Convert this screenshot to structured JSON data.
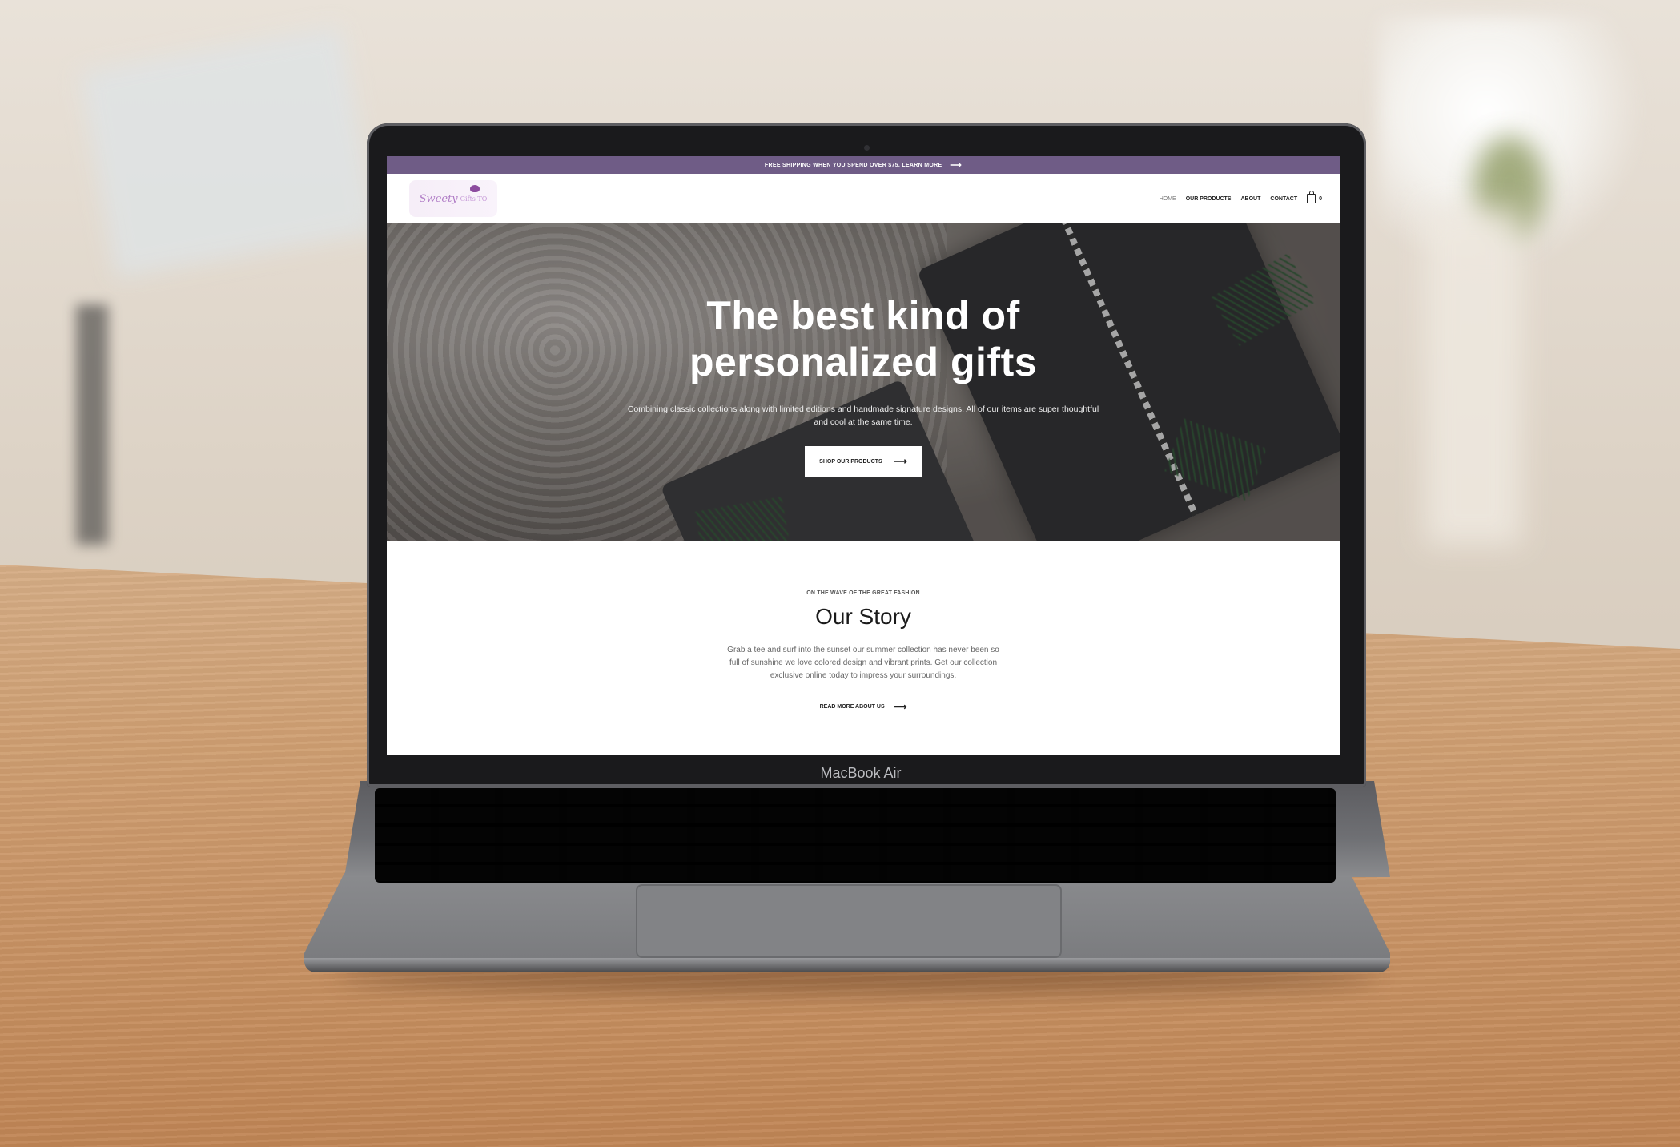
{
  "announcement": {
    "text": "FREE SHIPPING WHEN YOU SPEND OVER $75. LEARN MORE",
    "arrow": "⟶"
  },
  "logo": {
    "script": "Sweety",
    "sub": "Gifts TO"
  },
  "nav": {
    "items": [
      {
        "label": "HOME",
        "active": true
      },
      {
        "label": "OUR PRODUCTS",
        "active": false
      },
      {
        "label": "ABOUT",
        "active": false
      },
      {
        "label": "CONTACT",
        "active": false
      }
    ],
    "cart_count": "0",
    "cart_icon": "shopping-bag-icon"
  },
  "hero": {
    "title_line1": "The best kind of",
    "title_line2": "personalized gifts",
    "subtitle": "Combining classic collections along with limited editions and handmade signature designs. All of our items are super thoughtful and cool at the same time.",
    "button_label": "SHOP OUR PRODUCTS",
    "button_arrow": "⟶"
  },
  "story": {
    "eyebrow": "ON THE WAVE OF THE GREAT FASHION",
    "title": "Our Story",
    "text": "Grab a tee and surf into the sunset our summer collection has never been so full of sunshine we love colored design and vibrant prints. Get our collection exclusive online today to impress your surroundings.",
    "link_label": "READ MORE ABOUT US",
    "link_arrow": "⟶"
  },
  "device": {
    "label": "MacBook Air"
  },
  "colors": {
    "announcement_bg": "#6f5c86",
    "logo_accent": "#b07cc6"
  }
}
